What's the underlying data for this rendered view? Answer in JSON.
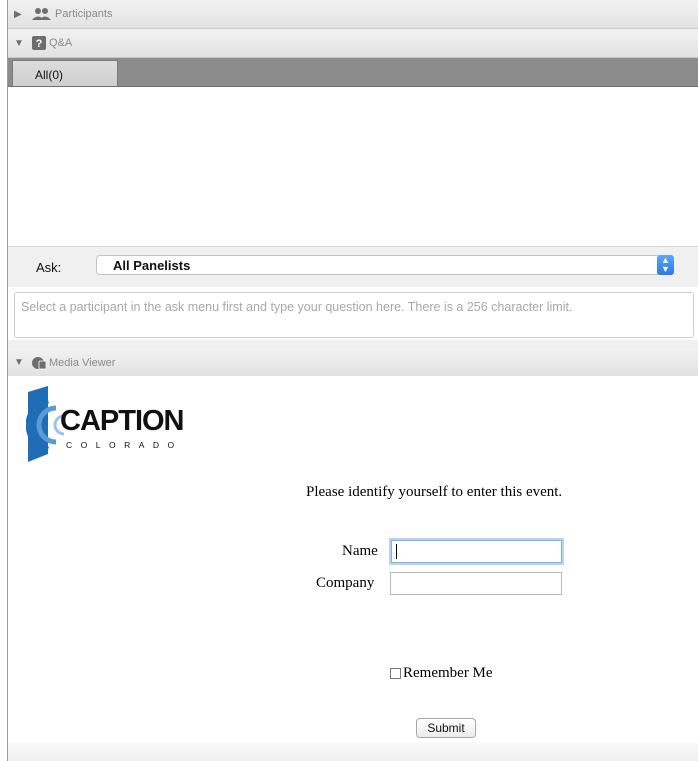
{
  "panels": {
    "participants": {
      "title": "Participants",
      "icon": "participants-icon",
      "expanded": false
    },
    "qa": {
      "title": "Q&A",
      "icon": "question-icon",
      "expanded": true
    },
    "media": {
      "title": "Media Viewer",
      "icon": "media-viewer-icon",
      "expanded": true
    }
  },
  "qa_tabs": [
    {
      "label": "All(0)",
      "selected": true
    }
  ],
  "ask": {
    "label": "Ask:",
    "selected": "All Panelists",
    "question_placeholder": "Select a participant in the ask menu first and type your question here. There is a 256 character limit."
  },
  "media_viewer": {
    "logo": {
      "text_main": "CAPTION",
      "text_sub": "COLORADO",
      "accent_color": "#1f6db5"
    },
    "prompt": "Please identify yourself to enter this event.",
    "fields": [
      {
        "label": "Name",
        "value": "",
        "focused": true
      },
      {
        "label": "Company",
        "value": "",
        "focused": false
      }
    ],
    "remember_me": {
      "label": "Remember Me",
      "checked": false
    },
    "submit_label": "Submit"
  },
  "colors": {
    "tab_bar": "#8c8c8c",
    "select_accent": "#2a7ae2",
    "header_text": "#8a8a8a"
  }
}
